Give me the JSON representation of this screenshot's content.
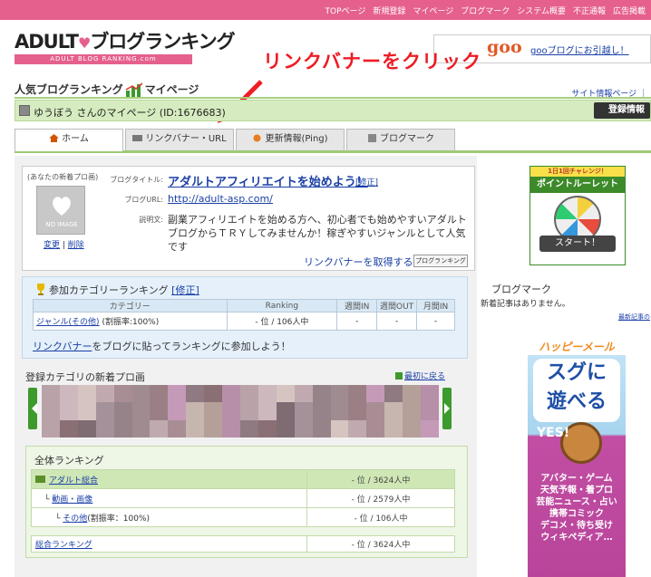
{
  "topnav": {
    "items": [
      "TOPページ",
      "新規登録",
      "マイページ",
      "ブログマーク",
      "システム概要",
      "不正通報",
      "広告掲載"
    ]
  },
  "logo": {
    "main": "ADULT",
    "main2": "ブログランキング",
    "sub": "ADULT BLOG RANKING.com"
  },
  "goo": {
    "brand": "goo",
    "text": "gooブログにお引越し！"
  },
  "annotation": "リンクバナーをクリック",
  "heading": {
    "part1": "人気ブログランキング",
    "part2": "マイページ",
    "sitelinks": "サイト情報ページ ｜"
  },
  "userbar": {
    "name": "ゆうぼう さんのマイページ (ID:1676683)",
    "register_label": "登録情報"
  },
  "tabs": [
    {
      "label": "ホーム"
    },
    {
      "label": "リンクバナー・URL"
    },
    {
      "label": "更新情報(Ping)"
    },
    {
      "label": "ブログマーク"
    }
  ],
  "blog": {
    "newest_label": "(あなたの新着プロ画)",
    "noimage": "NO IMAGE",
    "change": "変更",
    "delete": "削除",
    "title_label": "ブログタイトル:",
    "title": "アダルトアフィリエイトを始めよう！",
    "edit": "[修正]",
    "url_label": "ブログURL:",
    "url": "http://adult-asp.com/",
    "desc_label": "説明文:",
    "desc": "副業アフィリエイトを始める方へ、初心者でも始めやすいアダルトブログからＴＲＹしてみませんか！稼ぎやすいジャンルとして人気です",
    "get_banner": "リンクバナーを取得する",
    "banner_btn": "プログランキング"
  },
  "category": {
    "title": "参加カテゴリーランキング",
    "edit": "[修正]",
    "headers": [
      "カテゴリー",
      "Ranking",
      "週間IN",
      "週間OUT",
      "月間IN"
    ],
    "row": {
      "name": "ジャンル(その他)",
      "rate": "(割振率:100%)",
      "ranking": "- 位 / 106人中",
      "week_in": "-",
      "week_out": "-",
      "month_in": "-"
    },
    "footer_link": "リンクバナー",
    "footer_rest": "をブログに貼ってランキングに参加しよう！"
  },
  "newblogs": {
    "title": "登録カテゴリの新着プロ画",
    "back": "最初に戻る"
  },
  "overall": {
    "title": "全体ランキング",
    "rows": [
      {
        "name": "アダルト総合",
        "value": "- 位 / 3624人中"
      },
      {
        "name": "動画・画像",
        "value": "- 位 / 2579人中"
      },
      {
        "name": "その他",
        "suffix": "(割振率：100%)",
        "value": "- 位 / 106人中"
      }
    ],
    "total": {
      "name": "総合ランキング",
      "value": "- 位 / 3624人中"
    }
  },
  "right": {
    "roulette_top": "1日1回チャレンジ！",
    "roulette_title": "ポイントルーレット",
    "roulette_start": "スタート！",
    "bm_title": "ブログマーク",
    "bm_text": "新着記事はありません。",
    "bm_more": "最新記事の",
    "ad_head": "ハッピーメール",
    "ad_big1": "スグに",
    "ad_big2": "遊べる",
    "ad_yes": "YES!",
    "ad_lines": [
      "アバター・ゲーム",
      "天気予報・着プロ",
      "芸能ニュース・占い",
      "携帯コミック",
      "デコメ・待ち受け",
      "ウィキペディア…"
    ]
  },
  "colors": {
    "nav_pink": "#e5608d",
    "green_bar": "#d6ecc0",
    "link_blue": "#1a3fa6",
    "annotation_red": "#ee1c24"
  }
}
